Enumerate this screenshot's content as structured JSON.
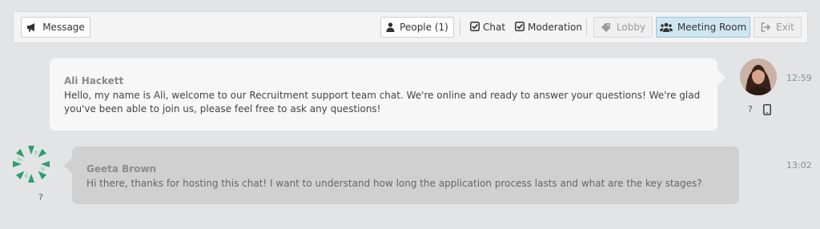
{
  "toolbar": {
    "message_label": "Message",
    "people_label": "People (1)",
    "chat_label": "Chat",
    "moderation_label": "Moderation",
    "lobby_label": "Lobby",
    "meeting_room_label": "Meeting Room",
    "exit_label": "Exit"
  },
  "messages": [
    {
      "author": "Ali Hackett",
      "text": "Hello, my name is Ali, welcome to our Recruitment support team chat. We're online and ready to answer your questions! We're glad you've been able to join us, please feel free to ask any questions!",
      "time": "12:59",
      "status": "?"
    },
    {
      "author": "Geeta Brown",
      "text": "Hi there, thanks for hosting this chat! I want to understand how long the application process lasts and what are the key stages?",
      "time": "13:02",
      "status": "?"
    }
  ],
  "colors": {
    "background": "#e3e4e6",
    "active_tab": "#cfe6f1",
    "own_bubble": "#f7f7f7",
    "other_bubble": "#d0d0d0",
    "logo_green": "#2e9e6b"
  },
  "icons": {
    "message": "megaphone-icon",
    "people": "user-icon",
    "chat": "checkbox-checked-icon",
    "moderation": "checkbox-checked-icon",
    "lobby": "tag-icon",
    "meeting_room": "group-icon",
    "exit": "sign-out-icon",
    "device": "tablet-icon"
  }
}
